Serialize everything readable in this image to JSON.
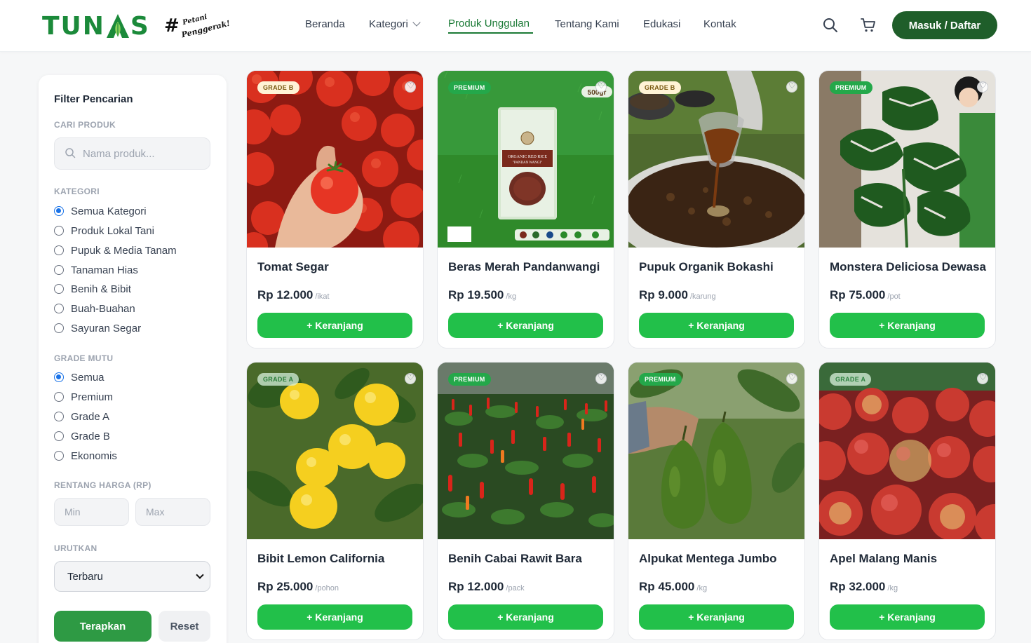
{
  "brand": {
    "logo_text_left": "TUN",
    "logo_text_right": "S",
    "tagline_hash": "#",
    "tagline_line1": "Petani",
    "tagline_line2": "Penggerak!"
  },
  "nav": {
    "items": [
      {
        "label": "Beranda"
      },
      {
        "label": "Kategori"
      },
      {
        "label": "Produk Unggulan"
      },
      {
        "label": "Tentang Kami"
      },
      {
        "label": "Edukasi"
      },
      {
        "label": "Kontak"
      }
    ],
    "login_label": "Masuk / Daftar",
    "accent_color": "#1f5e2a"
  },
  "sidebar": {
    "title": "Filter Pencarian",
    "search_label": "CARI PRODUK",
    "search_placeholder": "Nama produk...",
    "category_label": "KATEGORI",
    "categories": [
      {
        "label": "Semua Kategori",
        "checked": true
      },
      {
        "label": "Produk Lokal Tani",
        "checked": false
      },
      {
        "label": "Pupuk & Media Tanam",
        "checked": false
      },
      {
        "label": "Tanaman Hias",
        "checked": false
      },
      {
        "label": "Benih & Bibit",
        "checked": false
      },
      {
        "label": "Buah-Buahan",
        "checked": false
      },
      {
        "label": "Sayuran Segar",
        "checked": false
      }
    ],
    "grade_label": "GRADE MUTU",
    "grades": [
      {
        "label": "Semua",
        "checked": true
      },
      {
        "label": "Premium",
        "checked": false
      },
      {
        "label": "Grade A",
        "checked": false
      },
      {
        "label": "Grade B",
        "checked": false
      },
      {
        "label": "Ekonomis",
        "checked": false
      }
    ],
    "price_label": "RENTANG HARGA (RP)",
    "price_min_placeholder": "Min",
    "price_max_placeholder": "Max",
    "sort_label": "URUTKAN",
    "sort_selected": "Terbaru",
    "apply_label": "Terapkan",
    "reset_label": "Reset"
  },
  "products": [
    {
      "name": "Tomat Segar",
      "price": "Rp 12.000",
      "unit": "/ikat",
      "badge": "GRADE B",
      "image": "tomatoes",
      "button": "+ Keranjang"
    },
    {
      "name": "Beras Merah Pandanwangi",
      "price": "Rp 19.500",
      "unit": "/kg",
      "badge": "PREMIUM",
      "image": "red-rice-package",
      "button": "+ Keranjang"
    },
    {
      "name": "Pupuk Organik Bokashi",
      "price": "Rp 9.000",
      "unit": "/karung",
      "badge": "GRADE B",
      "image": "bokashi-fertilizer",
      "button": "+ Keranjang"
    },
    {
      "name": "Monstera Deliciosa Dewasa",
      "price": "Rp 75.000",
      "unit": "/pot",
      "badge": "PREMIUM",
      "image": "monstera-plant",
      "button": "+ Keranjang"
    },
    {
      "name": "Bibit Lemon California",
      "price": "Rp 25.000",
      "unit": "/pohon",
      "badge": "GRADE A",
      "image": "lemons",
      "button": "+ Keranjang"
    },
    {
      "name": "Benih Cabai Rawit Bara",
      "price": "Rp 12.000",
      "unit": "/pack",
      "badge": "PREMIUM",
      "image": "chili-plants",
      "button": "+ Keranjang"
    },
    {
      "name": "Alpukat Mentega Jumbo",
      "price": "Rp 45.000",
      "unit": "/kg",
      "badge": "PREMIUM",
      "image": "avocados",
      "button": "+ Keranjang"
    },
    {
      "name": "Apel Malang Manis",
      "price": "Rp 32.000",
      "unit": "/kg",
      "badge": "GRADE A",
      "image": "apples",
      "button": "+ Keranjang"
    }
  ],
  "rice_package": {
    "line1": "ORGANIC RED RICE",
    "line2": "\"PANDAN WANGI\"",
    "weight": "500gr"
  }
}
